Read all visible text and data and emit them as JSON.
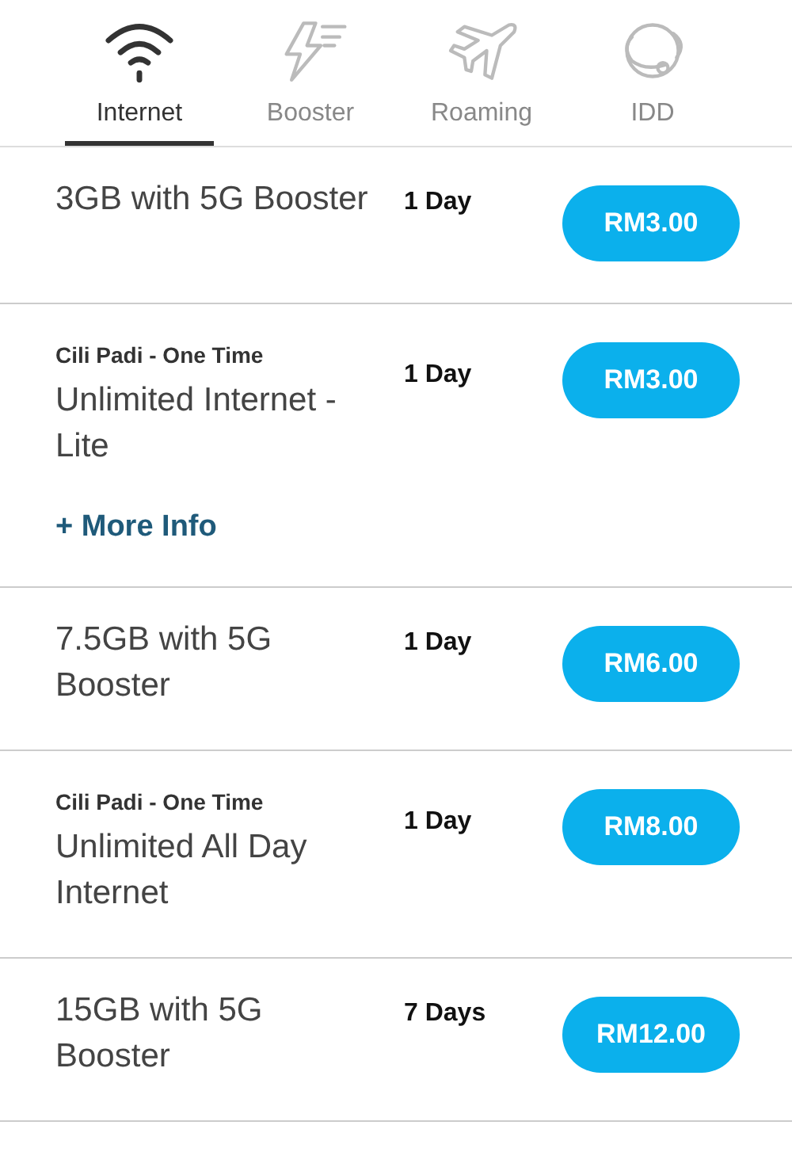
{
  "tabs": [
    {
      "label": "Internet",
      "kind": "wifi",
      "selected": true
    },
    {
      "label": "Booster",
      "kind": "bolt",
      "selected": false
    },
    {
      "label": "Roaming",
      "kind": "plane",
      "selected": false
    },
    {
      "label": "IDD",
      "kind": "globe",
      "selected": false
    }
  ],
  "plans": [
    {
      "name": "3GB with 5G Booster",
      "duration": "1 Day",
      "price": "RM3.00"
    },
    {
      "category": "Cili Padi - One Time",
      "name": "Unlimited Internet - Lite",
      "duration": "1 Day",
      "price": "RM3.00",
      "more_info": "+ More Info"
    },
    {
      "name": "7.5GB with 5G Booster",
      "duration": "1 Day",
      "price": "RM6.00"
    },
    {
      "category": "Cili Padi - One Time",
      "name": "Unlimited All Day Internet",
      "duration": "1 Day",
      "price": "RM8.00"
    },
    {
      "name": "15GB with 5G Booster",
      "duration": "7 Days",
      "price": "RM12.00"
    }
  ]
}
